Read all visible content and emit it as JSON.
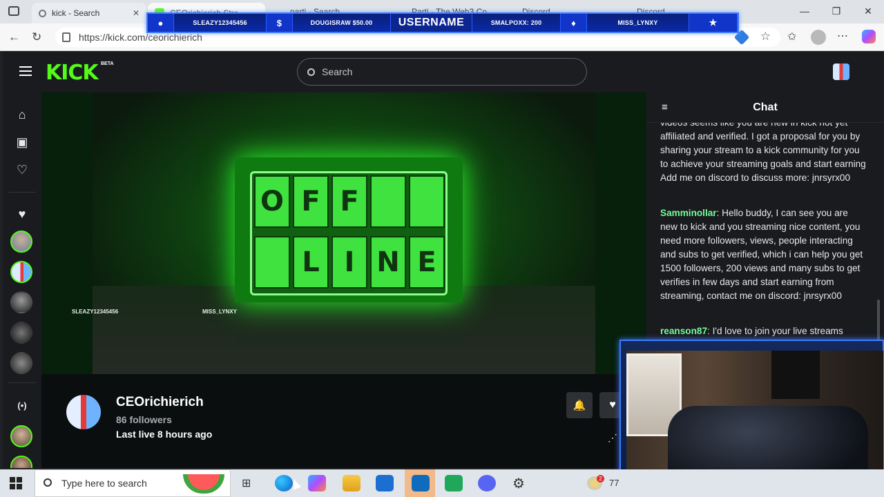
{
  "browser": {
    "tabs": [
      {
        "title": "kick - Search"
      },
      {
        "title": "CEOrichierich Stre…"
      },
      {
        "title": "parti - Search"
      },
      {
        "title": "Parti - The Web3 Co…"
      },
      {
        "title": "Discord"
      },
      {
        "title": "Discord"
      }
    ],
    "url": "https://kick.com/ceorichierich"
  },
  "overlay": {
    "items": [
      "SLEAZY12345456",
      "DOUGISRAW $50.00",
      "USERNAME",
      "SMALPOXX: 200",
      "MISS_LYNXY"
    ],
    "icons": [
      "user-icon",
      "dollar-icon",
      "drop-icon",
      "star-icon"
    ]
  },
  "kick": {
    "logo": "KICK",
    "beta": "BETA",
    "search_placeholder": "Search",
    "player": {
      "offline_top": [
        "O",
        "F",
        "F",
        "",
        ""
      ],
      "offline_bottom": [
        "",
        "L",
        "I",
        "N",
        "E"
      ],
      "label_left": "SLEAZY12345456",
      "label_right": "MISS_LYNXY"
    },
    "channel": {
      "name": "CEOrichierich",
      "followers": "86 followers",
      "last_live": "Last live 8 hours ago"
    },
    "chat": {
      "title": "Chat",
      "messages": [
        {
          "user": "",
          "text": "videos seems like you are new in kick not yet affiliated and verified. I got a proposal for you by sharing your stream to a kick community for you to achieve your streaming goals and start earning Add me on discord to discuss more: jnrsyrx00"
        },
        {
          "user": "Samminollar",
          "text": ": Hello buddy, I can see you are new to kick and you streaming nice content, you need more followers, views, people interacting and subs to get verified, which i can help you get 1500 followers, 200 views and many subs to get verifies in few days and start earning from streaming, contact me on discord: jnrsyrx00"
        },
        {
          "user": "reanson87",
          "text": ": I'd love to join your live streams"
        }
      ]
    }
  },
  "taskbar": {
    "search_placeholder": "Type here to search",
    "weather_temp": "77",
    "notif_count": "2"
  },
  "colors": {
    "kick_green": "#53fc18",
    "overlay_blue": "#0a2aa8",
    "chat_user_green": "#75fd98"
  }
}
